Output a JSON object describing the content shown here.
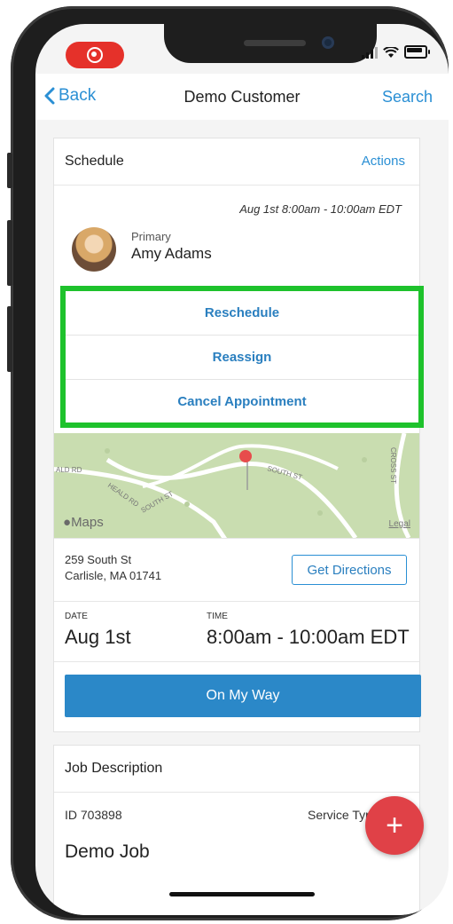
{
  "nav": {
    "back_label": "Back",
    "title": "Demo Customer",
    "search_label": "Search"
  },
  "schedule": {
    "title": "Schedule",
    "actions_label": "Actions",
    "time_range": "Aug 1st 8:00am - 10:00am EDT",
    "role": "Primary",
    "person": "Amy Adams",
    "menu": [
      "Reschedule",
      "Reassign",
      "Cancel Appointment"
    ]
  },
  "map": {
    "logo": "Maps",
    "legal": "Legal",
    "street_labels": [
      "ALD RD",
      "HEALD RD",
      "SOUTH ST",
      "SOUTH ST",
      "CROSS ST"
    ]
  },
  "address": {
    "line1": "259 South St",
    "line2": "Carlisle, MA 01741",
    "directions_label": "Get Directions"
  },
  "datetime": {
    "date_label": "DATE",
    "date_value": "Aug 1st",
    "time_label": "TIME",
    "time_value": "8:00am - 10:00am EDT"
  },
  "on_my_way_label": "On My Way",
  "job": {
    "title": "Job Description",
    "id": "ID 703898",
    "service_type_label": "Service Type",
    "name": "Demo Job"
  },
  "fab_symbol": "+",
  "colors": {
    "accent": "#2a8fd4",
    "primary_button": "#2b88c8",
    "highlight": "#1ec22c",
    "fab": "#e04147",
    "record": "#e5312a"
  }
}
